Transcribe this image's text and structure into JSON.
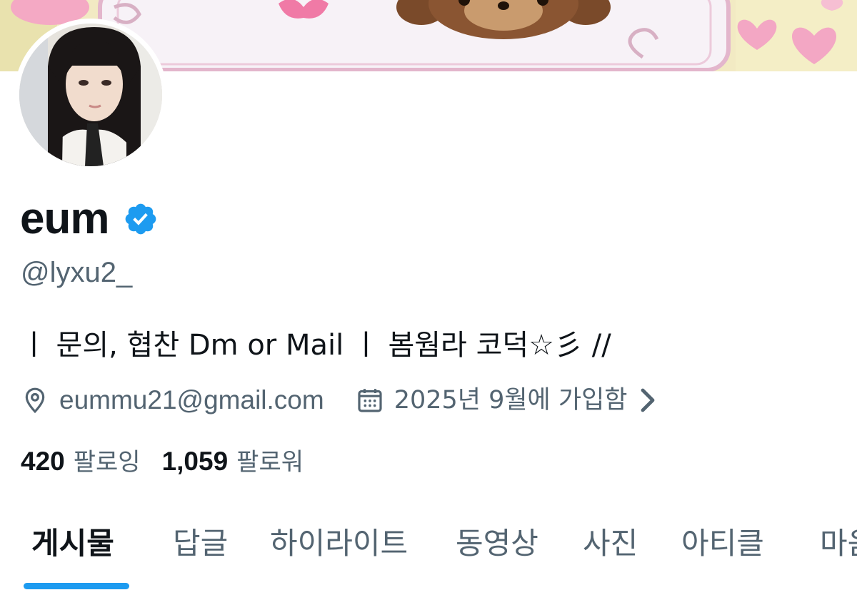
{
  "profile": {
    "display_name": "eum",
    "verified": true,
    "handle": "@lyxu2_",
    "bio": "ㅣ 문의, 협찬 Dm or Mail ㅣ 봄웜라 코덕☆彡 //",
    "location": "eummu21@gmail.com",
    "joined": "2025년 9월에 가입함"
  },
  "stats": {
    "following_count": "420",
    "following_label": "팔로잉",
    "followers_count": "1,059",
    "followers_label": "팔로워"
  },
  "tabs": [
    {
      "label": "게시물",
      "active": true
    },
    {
      "label": "답글",
      "active": false
    },
    {
      "label": "하이라이트",
      "active": false
    },
    {
      "label": "동영상",
      "active": false
    },
    {
      "label": "사진",
      "active": false
    },
    {
      "label": "아티클",
      "active": false
    },
    {
      "label": "마음",
      "active": false
    }
  ],
  "colors": {
    "accent": "#1d9bf0",
    "verified_badge": "#1d9bf0",
    "text_primary": "#0f1419",
    "text_secondary": "#536471"
  },
  "icons": {
    "verified": "verified-badge-icon",
    "location": "location-pin-icon",
    "calendar": "calendar-icon",
    "chevron": "chevron-right-icon"
  }
}
